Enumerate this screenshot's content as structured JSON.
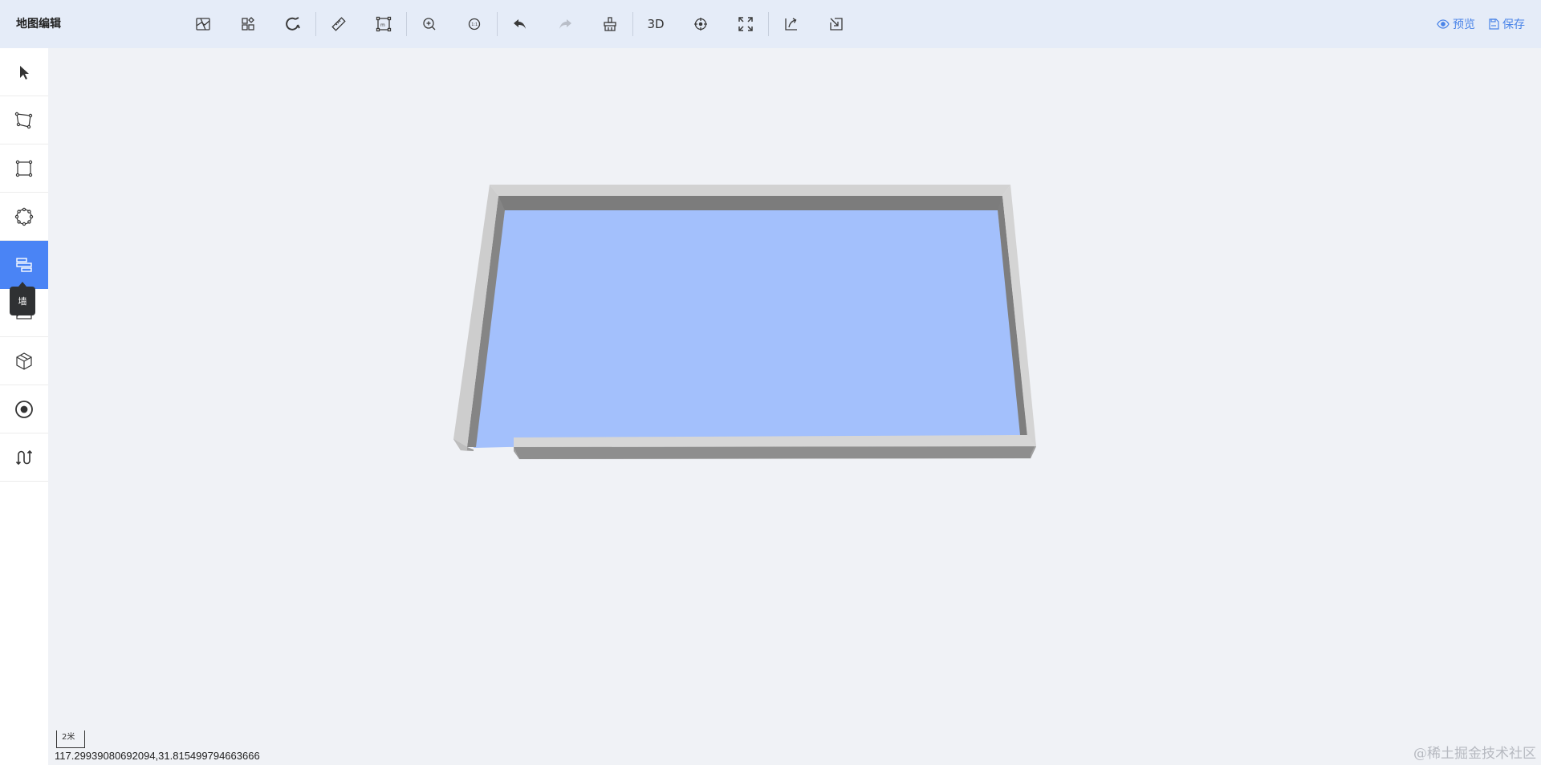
{
  "app": {
    "title": "地图编辑"
  },
  "toolbar": {
    "tools": [
      {
        "icon": "basemap-icon",
        "enabled": true
      },
      {
        "icon": "layers-icon",
        "enabled": true
      },
      {
        "icon": "magnet-snap-icon",
        "enabled": true
      },
      {
        "icon": "ruler-icon",
        "enabled": true
      },
      {
        "icon": "measure-area-icon",
        "enabled": true
      },
      {
        "icon": "zoom-in-icon",
        "enabled": true
      },
      {
        "icon": "zoom-reset-icon",
        "enabled": true
      },
      {
        "icon": "undo-icon",
        "enabled": true
      },
      {
        "icon": "redo-icon",
        "enabled": false
      },
      {
        "icon": "clear-icon",
        "enabled": true
      },
      {
        "icon": "3d-toggle",
        "label": "3D",
        "enabled": true
      },
      {
        "icon": "locate-icon",
        "enabled": true
      },
      {
        "icon": "fullscreen-icon",
        "enabled": true
      },
      {
        "icon": "export-icon",
        "enabled": true
      },
      {
        "icon": "import-icon",
        "enabled": true
      }
    ],
    "preview_label": "预览",
    "save_label": "保存"
  },
  "sidebar": {
    "items": [
      {
        "icon": "select-pointer-icon",
        "active": false
      },
      {
        "icon": "polygon-icon",
        "active": false
      },
      {
        "icon": "rectangle-icon",
        "active": false
      },
      {
        "icon": "circle-icon",
        "active": false
      },
      {
        "icon": "wall-icon",
        "active": true
      },
      {
        "icon": "image-icon",
        "active": false
      },
      {
        "icon": "model-cube-icon",
        "active": false
      },
      {
        "icon": "point-icon",
        "active": false
      },
      {
        "icon": "path-route-icon",
        "active": false
      }
    ],
    "tooltip": "墙"
  },
  "map": {
    "scale_label": "2米",
    "coordinates": "117.29939080692094,31.815499794663666",
    "floor_color": "#a3c0fc",
    "wall_top_color": "#d2d2d2",
    "wall_inner_color": "#7c7c7c"
  },
  "watermark": "@稀土掘金技术社区"
}
